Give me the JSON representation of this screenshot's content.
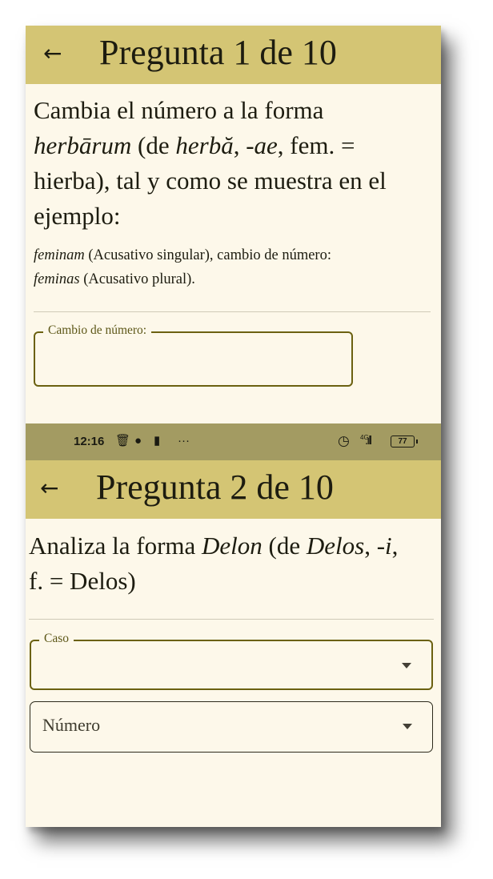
{
  "q1": {
    "title": "Pregunta 1 de 10",
    "prompt": {
      "line1": "Cambia el número a la forma",
      "form": "herbārum",
      "mid1": " (de ",
      "lemma": "herbă",
      "mid2": ", ",
      "gen": "-ae",
      "mid3": ", fem. =",
      "line3": "hierba), tal y como se muestra en el",
      "line4": "ejemplo:"
    },
    "example": {
      "form1": "feminam",
      "text1": " (Acusativo singular), cambio de número:",
      "form2": "feminas",
      "text2": " (Acusativo plural)."
    },
    "field_label": "Cambio de número:",
    "field_value": ""
  },
  "status_bar": {
    "time": "12:16",
    "network": "4G",
    "battery": "77",
    "icons": [
      "trash-icon",
      "moon-icon",
      "notification-icon",
      "more-icon",
      "alarm-icon",
      "signal-icon",
      "battery-icon"
    ]
  },
  "q2": {
    "title": "Pregunta 2 de 10",
    "prompt": {
      "pre": "Analiza la forma ",
      "form": "Delon",
      "mid1": " (de ",
      "lemma": "Delos",
      "mid2": ", ",
      "gen": "-i",
      "mid3": ",",
      "line2": "f. = Delos)"
    },
    "caso_label": "Caso",
    "numero_placeholder": "Número"
  },
  "colors": {
    "appbar": "#d4c574",
    "background": "#fdf8ea",
    "status_bar": "#a39b62",
    "field_border": "#6b6111"
  }
}
